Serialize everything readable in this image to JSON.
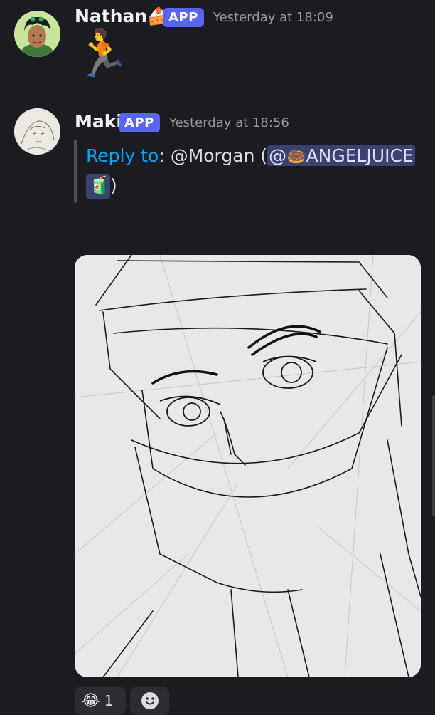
{
  "messages": [
    {
      "username": "Nathan",
      "username_emoji": "🍰",
      "badge": "APP",
      "timestamp": "Yesterday at 18:09",
      "content_emoji": "🏃"
    },
    {
      "username": "Maki",
      "badge": "APP",
      "timestamp": "Yesterday at 18:56",
      "reply": {
        "label": "Reply to",
        "colon": ":",
        "target": "@Morgan",
        "open_paren": "(",
        "mention_at": "@",
        "mention_emoji": "🍩",
        "mention_name": "ANGELJUICE",
        "mention_emoji_2": "🧃",
        "close_paren": ")"
      }
    }
  ],
  "reactions": [
    {
      "emoji": "😂",
      "count": "1"
    }
  ],
  "colors": {
    "background": "#1b1c22",
    "brand": "#5865f2",
    "reply_link": "#00a8fc",
    "mention_bg": "#3c4270"
  }
}
